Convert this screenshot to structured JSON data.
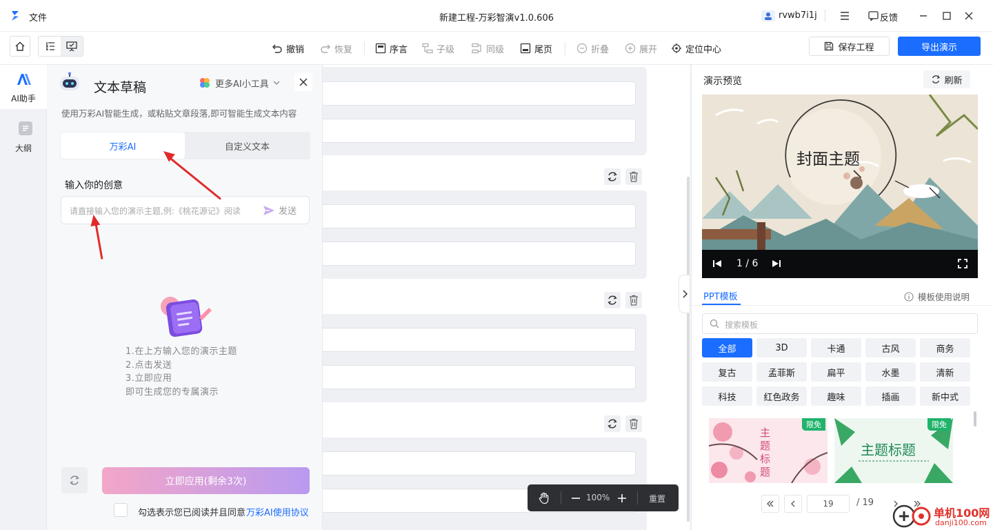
{
  "app": {
    "file_menu": "文件",
    "window_title": "新建工程-万彩智演v1.0.606",
    "username": "rvwb7i1j",
    "feedback": "反馈"
  },
  "toolbar": {
    "undo": "撤销",
    "redo": "恢复",
    "preface": "序言",
    "child": "子级",
    "sibling": "同级",
    "ending": "尾页",
    "collapse": "折叠",
    "expand": "展开",
    "locate_center": "定位中心",
    "save_project": "保存工程",
    "export": "导出演示"
  },
  "leftnav": {
    "ai_assistant": "AI助手",
    "outline": "大纲"
  },
  "ai_panel": {
    "title": "文本草稿",
    "more_tools": "更多AI小工具",
    "subtitle": "使用万彩AI智能生成，或粘贴文章段落,即可智能生成文本内容",
    "tab_ai": "万彩AI",
    "tab_custom": "自定义文本",
    "input_label": "输入你的创意",
    "input_placeholder": "请直接输入您的演示主题,例:《桃花源记》阅读",
    "send": "发送",
    "steps": [
      "1.在上方输入您的演示主题",
      "2.点击发送",
      "3.立即应用",
      "即可生成您的专属演示"
    ],
    "apply_button": "立即应用(剩余3次)",
    "agree_text": "勾选表示您已阅读并且同意",
    "agree_link": "万彩AI使用协议"
  },
  "canvas_controls": {
    "zoom": "100%",
    "reset": "重置"
  },
  "preview": {
    "header": "演示预览",
    "refresh": "刷新",
    "slide_title": "封面主题",
    "page_indicator": "1 / 6"
  },
  "templates": {
    "tab": "PPT模板",
    "help": "模板使用说明",
    "search_placeholder": "搜索模板",
    "tags": [
      "全部",
      "3D",
      "卡通",
      "古风",
      "商务",
      "复古",
      "孟菲斯",
      "扁平",
      "水墨",
      "清新",
      "科技",
      "红色政务",
      "趣味",
      "插画",
      "新中式"
    ],
    "active_tag": "全部",
    "card1_title": "主题标题",
    "card1_badge": "限免",
    "card2_title": "主题标题",
    "card2_badge": "限免",
    "page_current": "19",
    "page_total": "/ 19"
  },
  "watermark": {
    "site": "单机100网",
    "domain": "danji100.com"
  },
  "colors": {
    "primary": "#1a6dff",
    "apply_gradient_start": "#f3a6c8",
    "apply_gradient_end": "#b99af0",
    "arrow": "#e02a2a"
  }
}
